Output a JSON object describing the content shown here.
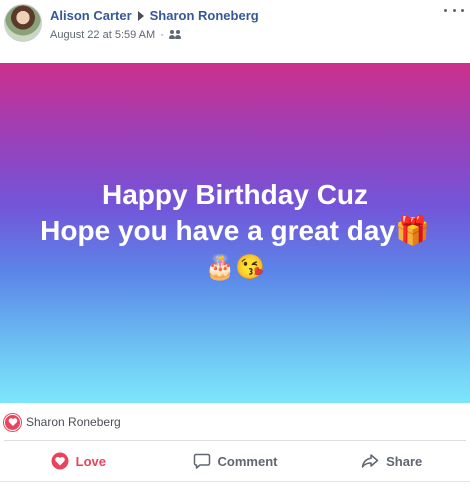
{
  "post": {
    "author": "Alison Carter",
    "recipient": "Sharon Roneberg",
    "timestamp": "August 22 at 5:59 AM",
    "separator": "·",
    "audience_icon": "friends-icon"
  },
  "banner": {
    "line1": "Happy Birthday Cuz",
    "line2": "Hope you have a great day🎁",
    "emoji_line": "🎂😘",
    "gradient_colors": [
      "#cc2f8c",
      "#9a40b9",
      "#7355d9",
      "#5b86e8",
      "#6bbef2",
      "#7de6fb"
    ]
  },
  "reactions": {
    "icon": "love-reaction-icon",
    "reactor": "Sharon Roneberg"
  },
  "actions": {
    "love_label": "Love",
    "comment_label": "Comment",
    "share_label": "Share"
  },
  "colors": {
    "link": "#365899",
    "love": "#e9435d",
    "muted": "#606770"
  }
}
